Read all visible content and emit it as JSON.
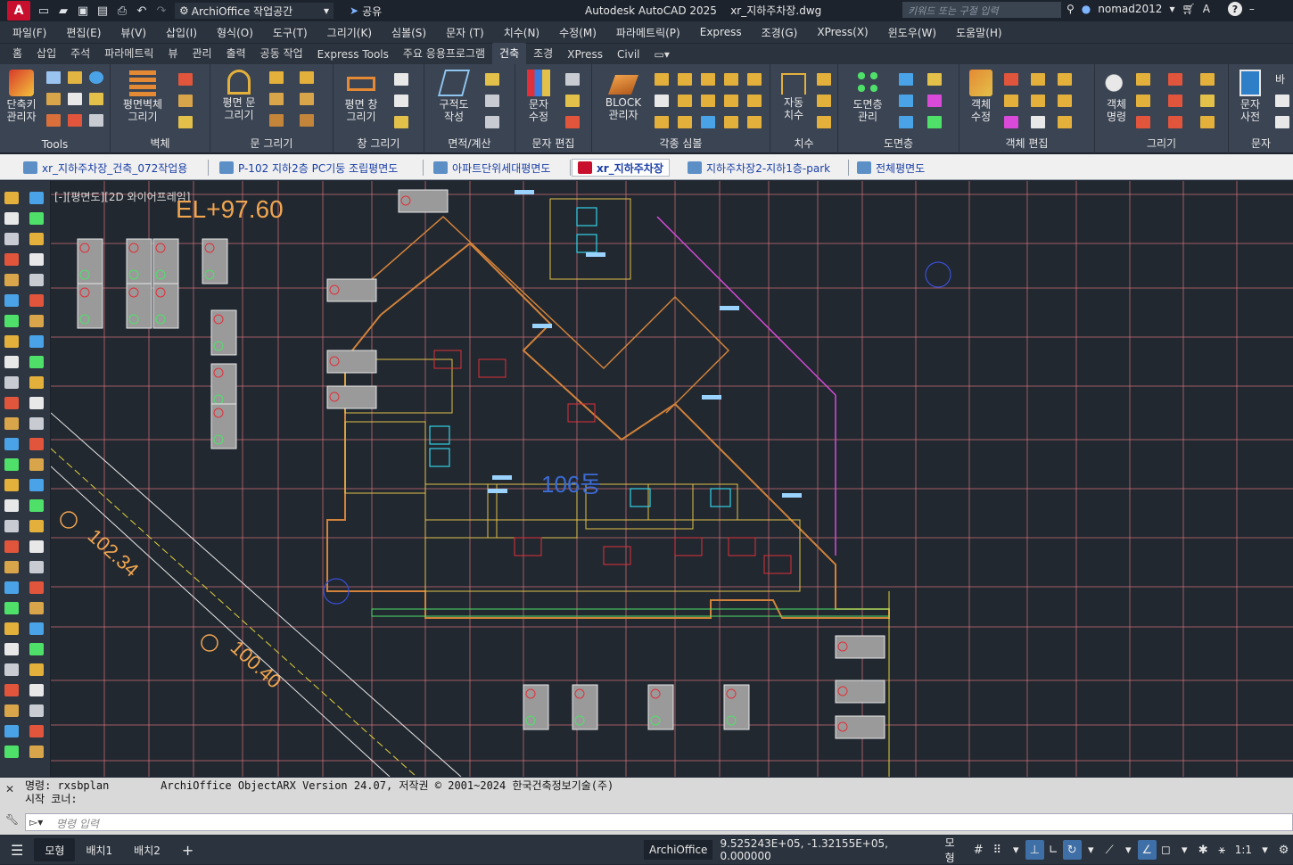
{
  "titlebar": {
    "logo_letter": "A",
    "workspace": "ArchiOffice 작업공간",
    "share": "공유",
    "app_title": "Autodesk AutoCAD 2025",
    "file_name": "xr_지하주차장.dwg",
    "search_placeholder": "키워드 또는 구절 입력",
    "user": "nomad2012"
  },
  "menubar": [
    "파일(F)",
    "편집(E)",
    "뷰(V)",
    "삽입(I)",
    "형식(O)",
    "도구(T)",
    "그리기(K)",
    "심볼(S)",
    "문자 (T)",
    "치수(N)",
    "수정(M)",
    "파라메트릭(P)",
    "Express",
    "조경(G)",
    "XPress(X)",
    "윈도우(W)",
    "도움말(H)"
  ],
  "ribbon_tabs": [
    "홈",
    "삽입",
    "주석",
    "파라메트릭",
    "뷰",
    "관리",
    "출력",
    "공동 작업",
    "Express Tools",
    "주요 응용프로그램",
    "건축",
    "조경",
    "XPress",
    "Civil"
  ],
  "active_ribbon_tab": "건축",
  "ribbon": {
    "panels": [
      "Tools",
      "벽체",
      "문 그리기",
      "창 그리기",
      "면적/계산",
      "문자 편집",
      "각종 심볼",
      "치수",
      "도면층",
      "객체 편집",
      "그리기",
      "문자"
    ],
    "buttons": {
      "shortcut_mgr": [
        "단축키",
        "관리자"
      ],
      "wall": [
        "평면벽체",
        "그리기"
      ],
      "door": [
        "평면 문",
        "그리기"
      ],
      "window": [
        "평면 창",
        "그리기"
      ],
      "zoning": [
        "구적도",
        "작성"
      ],
      "text_edit": [
        "문자",
        "수정"
      ],
      "block_mgr": [
        "BLOCK",
        "관리자"
      ],
      "auto_dim": [
        "자동",
        "치수"
      ],
      "layer_mgr": [
        "도면층",
        "관리"
      ],
      "obj_edit": [
        "객체",
        "수정"
      ],
      "obj_cmd": [
        "객체",
        "명령"
      ],
      "text_dict": [
        "문자",
        "사전"
      ],
      "overflow": "바"
    }
  },
  "doc_tabs": [
    {
      "label": "xr_지하주차장_건축_072작업용",
      "active": false
    },
    {
      "label": "P-102 지하2층 PC기둥 조립평면도",
      "active": false
    },
    {
      "label": "아파트단위세대평면도",
      "active": false
    },
    {
      "label": "xr_지하주차장",
      "active": true
    },
    {
      "label": "지하주차장2-지하1층-park",
      "active": false
    },
    {
      "label": "전체평면도",
      "active": false
    }
  ],
  "viewport": {
    "label": "[-][평면도][2D 와이어프레임]",
    "elevation": "EL+97.60",
    "building": "106동",
    "dim1": "102.34",
    "dim2": "100.40"
  },
  "command": {
    "history": [
      "명령: rxsbplan        ArchiOffice ObjectARX Version 24.07, 저작권 © 2001~2024 한국건축정보기술(주)",
      "시작 코너:"
    ],
    "placeholder": "명령 입력"
  },
  "statusbar": {
    "layouts": [
      "모형",
      "배치1",
      "배치2"
    ],
    "active_layout": "모형",
    "app": "ArchiOffice",
    "coordinates": "9.525243E+05, -1.32155E+05, 0.000000",
    "space": "모형",
    "scale": "1:1"
  },
  "colors": {
    "canvas_bg": "#212830",
    "grid_red": "#d9747a",
    "wall_orange": "#d2823a",
    "accent_blue": "#3e6fa7",
    "brand_red": "#c8102e"
  }
}
